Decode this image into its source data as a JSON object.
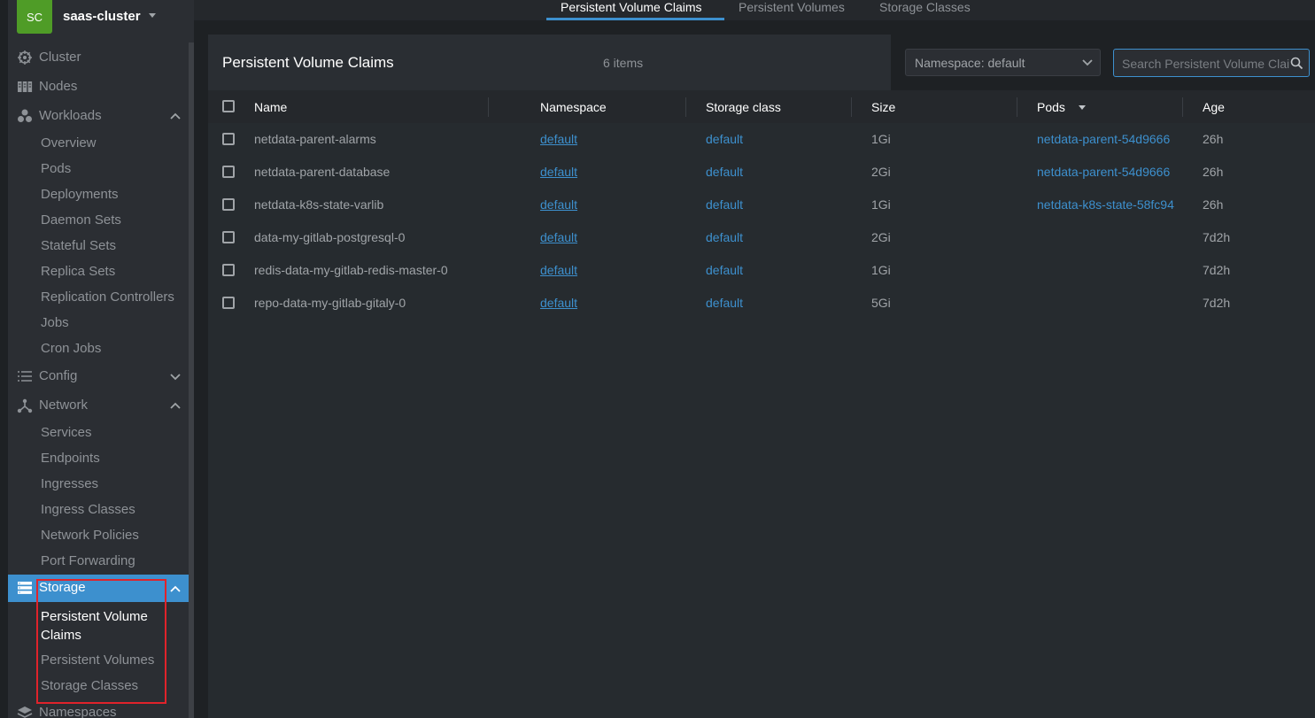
{
  "cluster": {
    "avatar": "SC",
    "name": "saas-cluster"
  },
  "sidebar": {
    "items": [
      {
        "label": "Cluster",
        "icon": "cluster-icon"
      },
      {
        "label": "Nodes",
        "icon": "nodes-icon"
      },
      {
        "label": "Workloads",
        "icon": "workloads-icon",
        "expanded": true
      },
      {
        "label": "Config",
        "icon": "config-icon",
        "expanded": false
      },
      {
        "label": "Network",
        "icon": "network-icon",
        "expanded": true
      },
      {
        "label": "Storage",
        "icon": "storage-icon",
        "expanded": true,
        "active": true
      },
      {
        "label": "Namespaces",
        "icon": "namespaces-icon"
      }
    ],
    "workloads": [
      "Overview",
      "Pods",
      "Deployments",
      "Daemon Sets",
      "Stateful Sets",
      "Replica Sets",
      "Replication Controllers",
      "Jobs",
      "Cron Jobs"
    ],
    "network": [
      "Services",
      "Endpoints",
      "Ingresses",
      "Ingress Classes",
      "Network Policies",
      "Port Forwarding"
    ],
    "storage": [
      "Persistent Volume Claims",
      "Persistent Volumes",
      "Storage Classes"
    ]
  },
  "tabs": [
    "Persistent Volume Claims",
    "Persistent Volumes",
    "Storage Classes"
  ],
  "page": {
    "title": "Persistent Volume Claims",
    "count": "6 items",
    "namespace_select": "Namespace: default",
    "search_placeholder": "Search Persistent Volume Claims..."
  },
  "table": {
    "columns": [
      "Name",
      "Namespace",
      "Storage class",
      "Size",
      "Pods",
      "Age"
    ],
    "rows": [
      {
        "name": "netdata-parent-alarms",
        "namespace": "default",
        "storage_class": "default",
        "size": "1Gi",
        "pods": "netdata-parent-54d9666",
        "age": "26h"
      },
      {
        "name": "netdata-parent-database",
        "namespace": "default",
        "storage_class": "default",
        "size": "2Gi",
        "pods": "netdata-parent-54d9666",
        "age": "26h"
      },
      {
        "name": "netdata-k8s-state-varlib",
        "namespace": "default",
        "storage_class": "default",
        "size": "1Gi",
        "pods": "netdata-k8s-state-58fc94",
        "age": "26h"
      },
      {
        "name": "data-my-gitlab-postgresql-0",
        "namespace": "default",
        "storage_class": "default",
        "size": "2Gi",
        "pods": "",
        "age": "7d2h"
      },
      {
        "name": "redis-data-my-gitlab-redis-master-0",
        "namespace": "default",
        "storage_class": "default",
        "size": "1Gi",
        "pods": "",
        "age": "7d2h"
      },
      {
        "name": "repo-data-my-gitlab-gitaly-0",
        "namespace": "default",
        "storage_class": "default",
        "size": "5Gi",
        "pods": "",
        "age": "7d2h"
      }
    ]
  },
  "colors": {
    "accent": "#3d90ce",
    "avatar_bg": "#4f9c27",
    "highlight": "#e0232b"
  }
}
